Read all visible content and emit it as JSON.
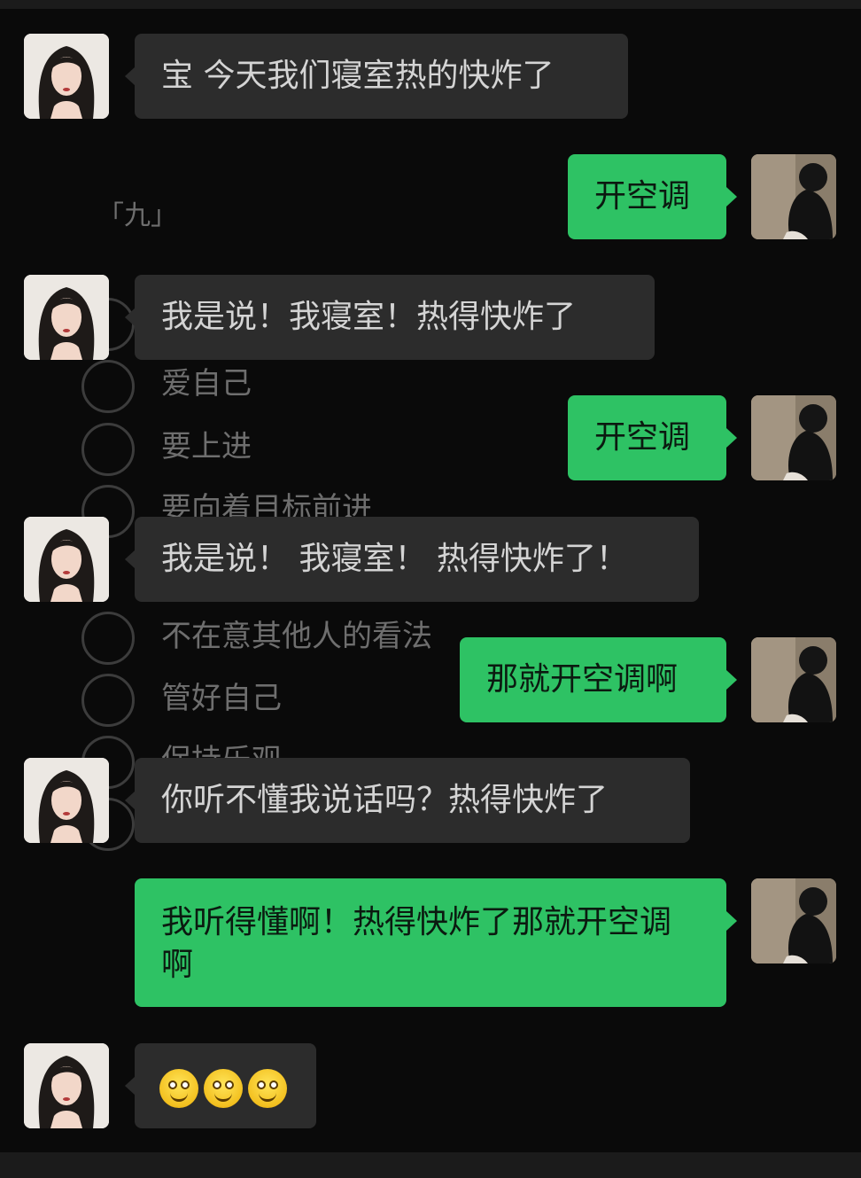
{
  "background_chars": {
    "heading": "「九」",
    "items": [
      "爱自己",
      "要上进",
      "要向着目标前进",
      "不在意其他人的看法",
      "管好自己",
      "保持乐观"
    ]
  },
  "colors": {
    "bg": "#0a0a0a",
    "incoming_bubble": "#2c2c2c",
    "outgoing_bubble": "#2ec264"
  },
  "messages": [
    {
      "side": "left",
      "text": "宝 今天我们寝室热的快炸了"
    },
    {
      "side": "right",
      "text": "开空调"
    },
    {
      "side": "left",
      "text": "我是说！我寝室！热得快炸了"
    },
    {
      "side": "right",
      "text": "开空调"
    },
    {
      "side": "left",
      "text": "我是说！ 我寝室！ 热得快炸了！"
    },
    {
      "side": "right",
      "text": "那就开空调啊"
    },
    {
      "side": "left",
      "text": "你听不懂我说话吗？热得快炸了"
    },
    {
      "side": "right",
      "text": "我听得懂啊！热得快炸了那就开空调啊"
    },
    {
      "side": "left",
      "emojis": [
        "smile-emoji",
        "smile-emoji",
        "smile-emoji"
      ]
    }
  ],
  "avatars": {
    "incoming": "girl-avatar",
    "outgoing": "boy-avatar"
  }
}
